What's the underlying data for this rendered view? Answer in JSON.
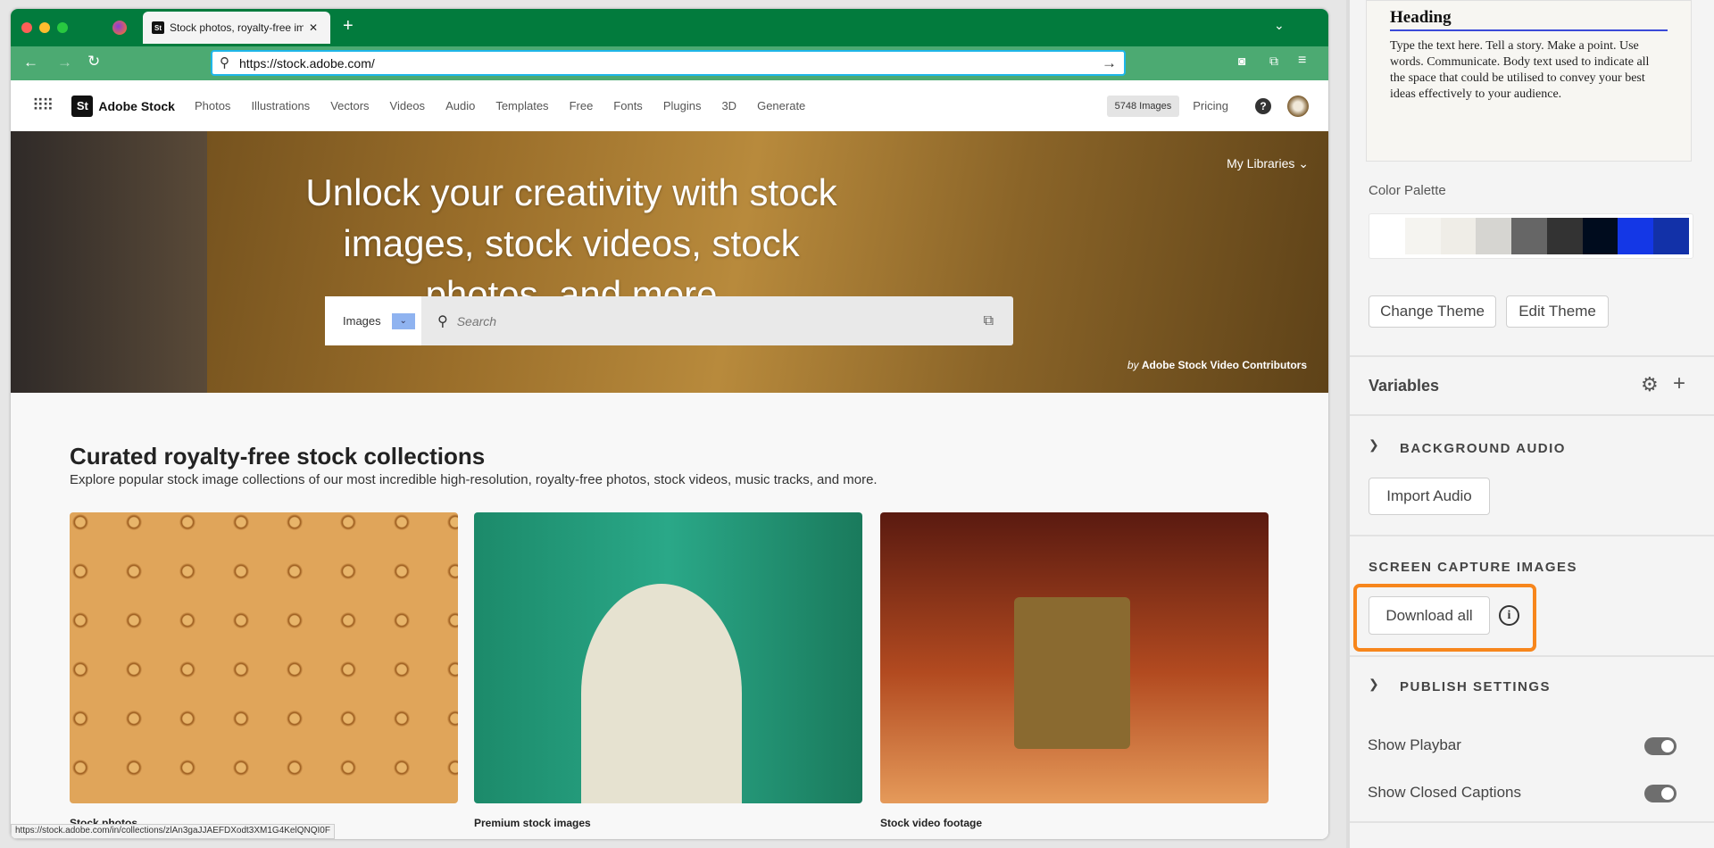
{
  "browser": {
    "tab_title": "Stock photos, royalty-free imag",
    "url": "https://stock.adobe.com/",
    "status_url": "https://stock.adobe.com/in/collections/zlAn3gaJJAEFDXodt3XM1G4KelQNQI0F"
  },
  "site": {
    "logo": "Adobe Stock",
    "logo_mark": "St",
    "nav": [
      "Photos",
      "Illustrations",
      "Vectors",
      "Videos",
      "Audio",
      "Templates",
      "Free",
      "Fonts",
      "Plugins",
      "3D",
      "Generate"
    ],
    "images_badge": "5748 Images",
    "pricing": "Pricing"
  },
  "hero": {
    "title": "Unlock your creativity with stock images, stock videos, stock photos, and more",
    "my_libraries": "My Libraries",
    "search_type": "Images",
    "search_placeholder": "Search",
    "credit_by": "by",
    "credit": "Adobe Stock Video Contributors"
  },
  "collections": {
    "title": "Curated royalty-free stock collections",
    "subtitle": "Explore popular stock image collections of our most incredible high-resolution, royalty-free photos, stock videos, music tracks, and more.",
    "items": [
      {
        "caption": "Stock photos"
      },
      {
        "caption": "Premium stock images"
      },
      {
        "caption": "Stock video footage"
      }
    ]
  },
  "panel": {
    "heading": "Heading",
    "body": "Type the text here. Tell a story. Make a point. Use words. Communicate. Body text used to indicate all the space that could be utilised to convey your best ideas effectively to your audience.",
    "palette_label": "Color Palette",
    "palette": [
      "#ffffff",
      "#f5f4f0",
      "#efede7",
      "#d6d5d1",
      "#666666",
      "#333333",
      "#000c1e",
      "#1437e6",
      "#1231a8"
    ],
    "change_theme": "Change Theme",
    "edit_theme": "Edit Theme",
    "variables": "Variables",
    "background_audio": "BACKGROUND AUDIO",
    "import_audio": "Import Audio",
    "screen_capture": "SCREEN CAPTURE IMAGES",
    "download_all": "Download all",
    "publish_settings": "PUBLISH SETTINGS",
    "show_playbar": "Show Playbar",
    "show_playbar_on": true,
    "show_cc": "Show Closed Captions",
    "show_cc_on": true,
    "highlight_color": "#f7861c"
  }
}
